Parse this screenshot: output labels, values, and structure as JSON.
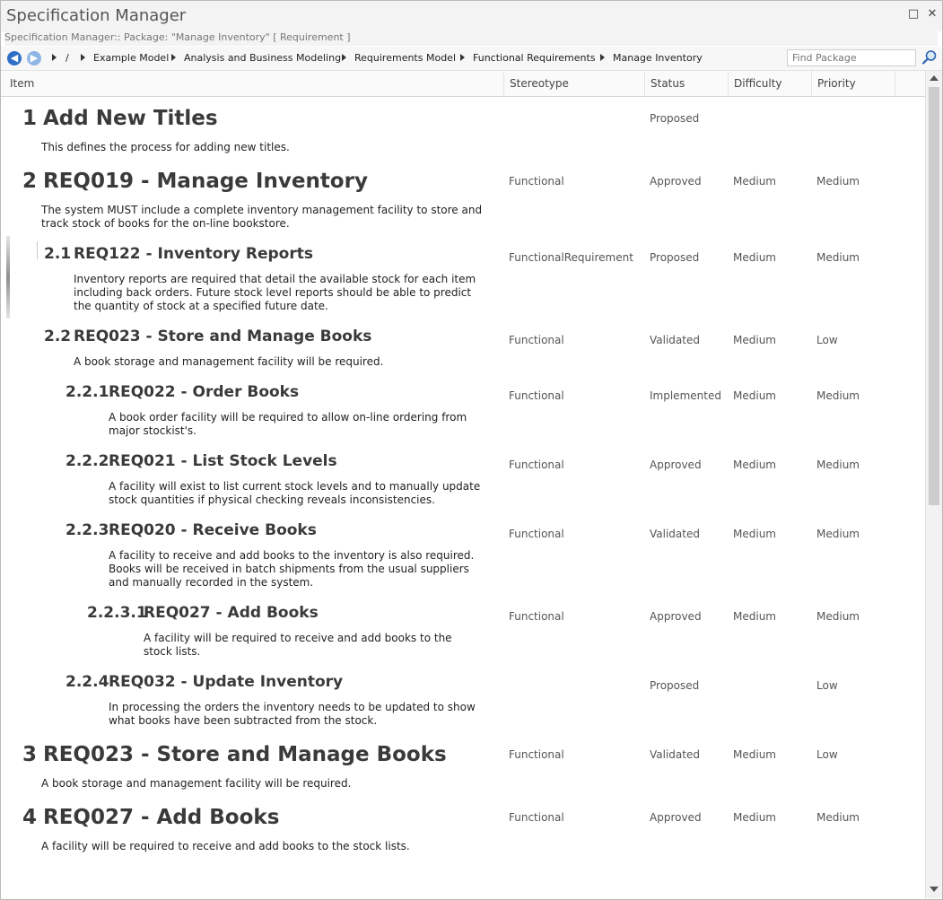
{
  "window": {
    "title": "Specification Manager",
    "subtitle": "Specification Manager::  Package: \"Manage Inventory\"  [ Requirement ]",
    "restore_glyph": "□",
    "close_glyph": "✕"
  },
  "navbar": {
    "back_icon": "back-arrow-icon",
    "forward_icon": "forward-arrow-icon",
    "root_label": "/",
    "breadcrumbs": [
      "Example Model",
      "Analysis and Business Modeling",
      "Requirements Model",
      "Functional Requirements",
      "Manage Inventory"
    ],
    "find_placeholder": "Find Package",
    "find_icon": "search-icon"
  },
  "columns": {
    "item": "Item",
    "stereotype": "Stereotype",
    "status": "Status",
    "difficulty": "Difficulty",
    "priority": "Priority"
  },
  "rows": [
    {
      "num": "1",
      "title": "Add New Titles",
      "desc": "This defines the process for adding new titles.",
      "stereotype": "",
      "status": "Proposed",
      "difficulty": "",
      "priority": ""
    },
    {
      "num": "2",
      "title": "REQ019 - Manage Inventory",
      "desc": "The system MUST include a complete inventory management facility to store and track stock of books for the on-line bookstore.",
      "stereotype": "Functional",
      "status": "Approved",
      "difficulty": "Medium",
      "priority": "Medium"
    },
    {
      "num": "2.1",
      "title": "REQ122 - Inventory Reports",
      "desc": "Inventory reports are required that detail the available stock for each item including back orders. Future stock level reports should be able to predict the quantity of stock at a specified future date.",
      "stereotype": "FunctionalRequirement",
      "status": "Proposed",
      "difficulty": "Medium",
      "priority": "Medium"
    },
    {
      "num": "2.2",
      "title": "REQ023 - Store and Manage Books",
      "desc": "A book storage and management facility will be required.",
      "stereotype": "Functional",
      "status": "Validated",
      "difficulty": "Medium",
      "priority": "Low"
    },
    {
      "num": "2.2.1",
      "title": "REQ022 - Order Books",
      "desc": "A book order facility will be required to allow on-line ordering from major stockist's.",
      "stereotype": "Functional",
      "status": "Implemented",
      "difficulty": "Medium",
      "priority": "Medium"
    },
    {
      "num": "2.2.2",
      "title": "REQ021 - List Stock Levels",
      "desc": "A facility will exist to list current stock levels and to manually update stock quantities if physical checking reveals inconsistencies.",
      "stereotype": "Functional",
      "status": "Approved",
      "difficulty": "Medium",
      "priority": "Medium"
    },
    {
      "num": "2.2.3",
      "title": "REQ020 - Receive Books",
      "desc": "A facility to receive and add books to the inventory is also required. Books will be received in batch shipments from the usual suppliers and manually recorded in the system.",
      "stereotype": "Functional",
      "status": "Validated",
      "difficulty": "Medium",
      "priority": "Medium"
    },
    {
      "num": "2.2.3.1",
      "title": "REQ027 - Add Books",
      "desc": "A facility will be required to receive and add books to the stock lists.",
      "stereotype": "Functional",
      "status": "Approved",
      "difficulty": "Medium",
      "priority": "Medium"
    },
    {
      "num": "2.2.4",
      "title": "REQ032 - Update Inventory",
      "desc": "In processing the orders the inventory needs to be updated to show what books have been subtracted from the stock.",
      "stereotype": "",
      "status": "Proposed",
      "difficulty": "",
      "priority": "Low"
    },
    {
      "num": "3",
      "title": "REQ023 - Store and Manage Books",
      "desc": "A book storage and management facility will be required.",
      "stereotype": "Functional",
      "status": "Validated",
      "difficulty": "Medium",
      "priority": "Low"
    },
    {
      "num": "4",
      "title": "REQ027 - Add Books",
      "desc": "A facility will be required to receive and add books to the stock lists.",
      "stereotype": "Functional",
      "status": "Approved",
      "difficulty": "Medium",
      "priority": "Medium"
    }
  ]
}
